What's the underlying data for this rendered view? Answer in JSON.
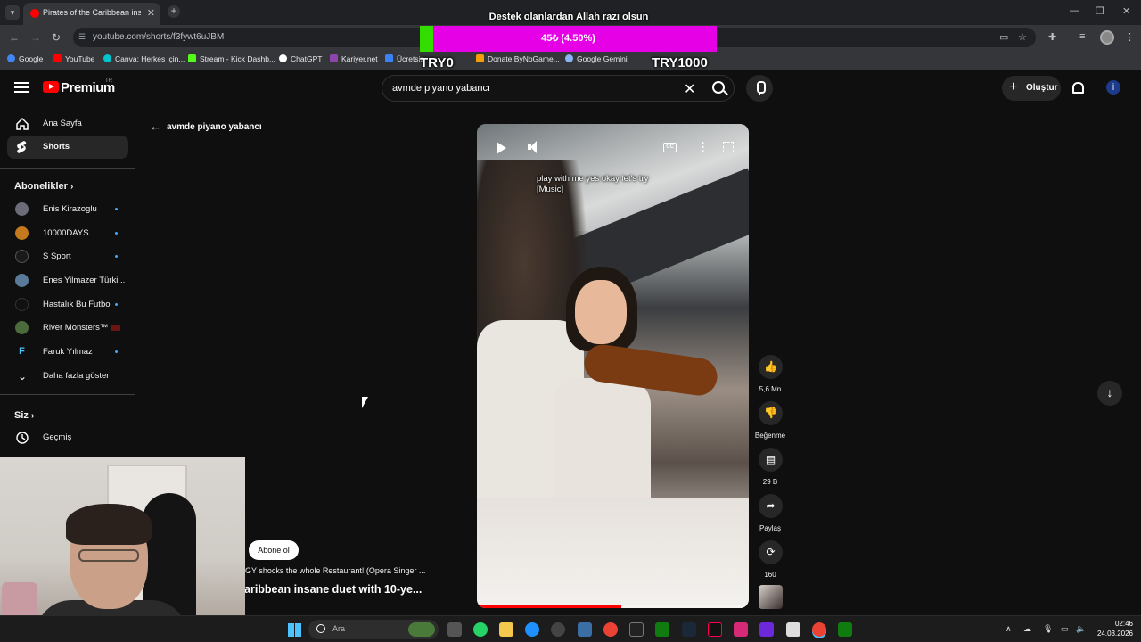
{
  "browser": {
    "tab_title": "Pirates of the Caribbean insane",
    "tab_close": "✕",
    "new_tab": "+",
    "url": "youtube.com/shorts/f3fywt6uJBM",
    "window_controls": [
      "—",
      "❐",
      "✕"
    ]
  },
  "bookmarks": [
    {
      "label": "Google",
      "color": "#4285f4"
    },
    {
      "label": "YouTube",
      "color": "#ff0000"
    },
    {
      "label": "Canva: Herkes için...",
      "color": "#00c4cc"
    },
    {
      "label": "Stream - Kick Dashb...",
      "color": "#53fc18"
    },
    {
      "label": "ChatGPT",
      "color": "#ffffff"
    },
    {
      "label": "Kariyer.net",
      "color": "#8e44ad"
    },
    {
      "label": "Ücretsiz",
      "color": "#3b82f6"
    },
    {
      "label": "Donate ByNoGame...",
      "color": "#f59e0b"
    },
    {
      "label": "Google Gemini",
      "color": "#8ab4f8"
    }
  ],
  "donation": {
    "title": "Destek olanlardan Allah razı olsun",
    "progress_text": "45₺ (4.50%)",
    "progress_fraction": 0.045,
    "min_label": "TRY0",
    "max_label": "TRY1000",
    "colors": {
      "bar": "#e600e6",
      "fill": "#33dd00"
    }
  },
  "header": {
    "logo_text": "Premium",
    "logo_region": "TR",
    "search_value": "avmde piyano yabancı",
    "create_label": "Oluştur",
    "avatar_letter": "İ"
  },
  "sidebar": {
    "main_items": [
      {
        "label": "Ana Sayfa",
        "icon": "home-icon",
        "active": false
      },
      {
        "label": "Shorts",
        "icon": "shorts-icon",
        "active": true
      }
    ],
    "subscriptions_heading": "Abonelikler",
    "subscriptions": [
      {
        "label": "Enis Kirazoglu",
        "avatar_color": "#6b6b7a",
        "indicator": "dot"
      },
      {
        "label": "10000DAYS",
        "avatar_color": "#c47a1c",
        "indicator": "dot"
      },
      {
        "label": "S Sport",
        "avatar_color": "#1a1a1a",
        "indicator": "dot"
      },
      {
        "label": "Enes Yilmazer Türki...",
        "avatar_color": "#5a7a9a",
        "indicator": "none"
      },
      {
        "label": "Hastalık Bu Futbol",
        "avatar_color": "#111111",
        "indicator": "dot"
      },
      {
        "label": "River Monsters™",
        "avatar_color": "#4c6b3c",
        "indicator": "live"
      },
      {
        "label": "Faruk Yılmaz",
        "avatar_color": "#0f0f0f",
        "indicator": "dot"
      }
    ],
    "show_more": "Daha fazla göster",
    "you_heading": "Siz",
    "history": "Geçmiş"
  },
  "main": {
    "back_label": "avmde piyano yabancı",
    "caption": "play with me yes okay let's try\n[Music]",
    "cc_label": "CC",
    "progress_fraction": 0.53,
    "actions": [
      {
        "name": "like-button",
        "icon": "thumbs-up-icon",
        "glyph": "👍",
        "label": "5,6 Mn"
      },
      {
        "name": "dislike-button",
        "icon": "thumbs-down-icon",
        "glyph": "👎",
        "label": "Beğenme"
      },
      {
        "name": "comments-button",
        "icon": "comment-icon",
        "glyph": "▤",
        "label": "29 B"
      },
      {
        "name": "share-button",
        "icon": "share-icon",
        "glyph": "➦",
        "label": "Paylaş"
      },
      {
        "name": "remix-button",
        "icon": "remix-icon",
        "glyph": "⟳",
        "label": "160"
      }
    ],
    "next_glyph": "↓",
    "subscribe_label": "Abone ol",
    "prev_short_title": "GY shocks the whole Restaurant! (Opera Singer ...",
    "current_short_title": "aribbean insane duet with 10-ye..."
  },
  "taskbar": {
    "search_placeholder": "Ara",
    "time": "02:46",
    "date": "24.03.2026"
  }
}
